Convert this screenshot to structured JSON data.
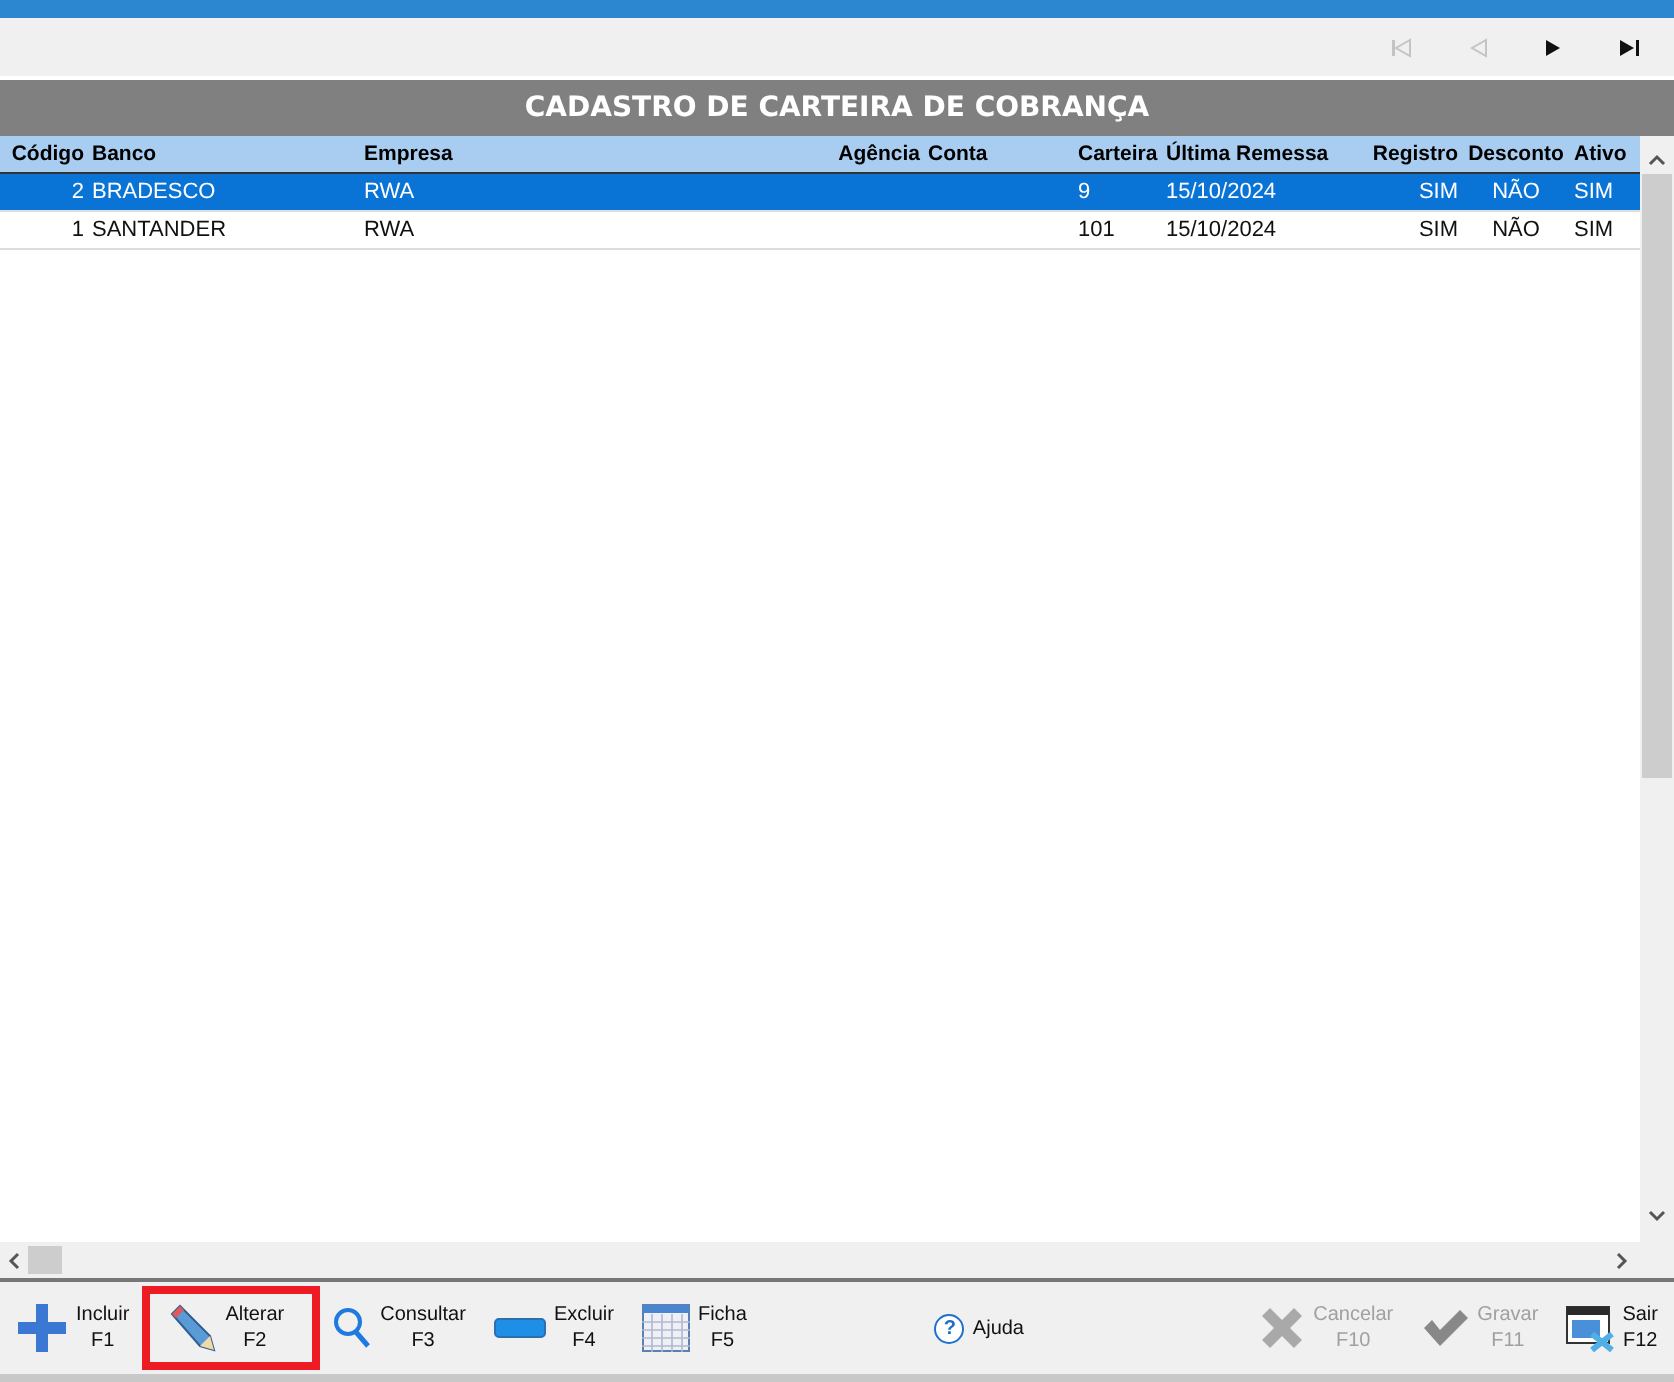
{
  "navigator": [
    {
      "kind": "first",
      "disabled": true
    },
    {
      "kind": "prev",
      "disabled": true
    },
    {
      "kind": "next",
      "disabled": false
    },
    {
      "kind": "last",
      "disabled": false
    }
  ],
  "title": "CADASTRO DE CARTEIRA DE COBRANÇA",
  "table": {
    "columns": [
      "Código",
      "Banco",
      "Empresa",
      "Agência",
      "Conta",
      "Carteira",
      "Última Remessa",
      "Registro",
      "Desconto",
      "Ativo"
    ],
    "rows": [
      {
        "selected": true,
        "cells": [
          "2",
          "BRADESCO",
          "RWA",
          "",
          "",
          "9",
          "15/10/2024",
          "SIM",
          "NÃO",
          "SIM"
        ]
      },
      {
        "selected": false,
        "cells": [
          "1",
          "SANTANDER",
          "RWA",
          "",
          "",
          "101",
          "15/10/2024",
          "SIM",
          "NÃO",
          "SIM"
        ]
      }
    ]
  },
  "toolbar": [
    {
      "kind": "plus",
      "label": "Incluir",
      "key": "F1",
      "disabled": false,
      "highlighted": false
    },
    {
      "kind": "pencil",
      "label": "Alterar",
      "key": "F2",
      "disabled": false,
      "highlighted": true
    },
    {
      "kind": "search",
      "label": "Consultar",
      "key": "F3",
      "disabled": false,
      "highlighted": false
    },
    {
      "kind": "minus",
      "label": "Excluir",
      "key": "F4",
      "disabled": false,
      "highlighted": false
    },
    {
      "kind": "grid",
      "label": "Ficha",
      "key": "F5",
      "disabled": false,
      "highlighted": false
    },
    {
      "kind": "help",
      "icon": "?",
      "label": "Ajuda",
      "disabled": false,
      "highlighted": false
    },
    {
      "kind": "cross",
      "label": "Cancelar",
      "key": "F10",
      "disabled": true,
      "highlighted": false
    },
    {
      "kind": "check",
      "label": "Gravar",
      "key": "F11",
      "disabled": true,
      "highlighted": false
    },
    {
      "kind": "exit",
      "label": "Sair",
      "key": "F12",
      "disabled": false,
      "highlighted": false
    }
  ]
}
